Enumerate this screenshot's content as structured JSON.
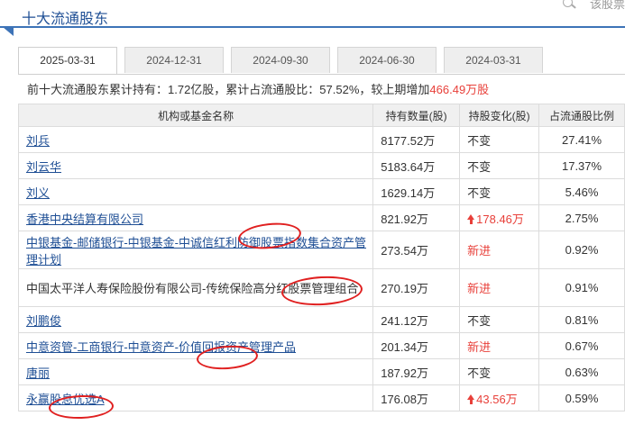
{
  "header": {
    "title": "十大流通股东",
    "search_text": "该股票"
  },
  "tabs": [
    {
      "label": "2025-03-31",
      "active": true
    },
    {
      "label": "2024-12-31",
      "active": false
    },
    {
      "label": "2024-09-30",
      "active": false
    },
    {
      "label": "2024-06-30",
      "active": false
    },
    {
      "label": "2024-03-31",
      "active": false
    }
  ],
  "summary": {
    "text_before": "前十大流通股东累计持有：1.72亿股，累计占流通股比：57.52%，较上期增加",
    "increase": "466.49万股"
  },
  "table": {
    "columns": [
      "机构或基金名称",
      "持有数量(股)",
      "持股变化(股)",
      "占流通股比例"
    ],
    "rows": [
      {
        "name": "刘兵",
        "link": true,
        "qty": "8177.52万",
        "change": "不变",
        "change_type": "same",
        "ratio": "27.41%"
      },
      {
        "name": "刘云华",
        "link": true,
        "qty": "5183.64万",
        "change": "不变",
        "change_type": "same",
        "ratio": "17.37%"
      },
      {
        "name": "刘义",
        "link": true,
        "qty": "1629.14万",
        "change": "不变",
        "change_type": "same",
        "ratio": "5.46%"
      },
      {
        "name": "香港中央结算有限公司",
        "link": true,
        "qty": "821.92万",
        "change": "178.46万",
        "change_type": "up",
        "ratio": "2.75%"
      },
      {
        "name": "中银基金-邮储银行-中银基金-中诚信红利防御股票指数集合资产管理计划",
        "link": true,
        "qty": "273.54万",
        "change": "新进",
        "change_type": "new",
        "ratio": "0.92%"
      },
      {
        "name": "中国太平洋人寿保险股份有限公司-传统保险高分红股票管理组合",
        "link": false,
        "qty": "270.19万",
        "change": "新进",
        "change_type": "new",
        "ratio": "0.91%"
      },
      {
        "name": "刘鹏俊",
        "link": true,
        "qty": "241.12万",
        "change": "不变",
        "change_type": "same",
        "ratio": "0.81%"
      },
      {
        "name": "中意资管-工商银行-中意资产-价值回报资产管理产品",
        "link": true,
        "qty": "201.34万",
        "change": "新进",
        "change_type": "new",
        "ratio": "0.67%"
      },
      {
        "name": "唐丽",
        "link": true,
        "qty": "187.92万",
        "change": "不变",
        "change_type": "same",
        "ratio": "0.63%"
      },
      {
        "name": "永赢股息优选A",
        "link": true,
        "qty": "176.08万",
        "change": "43.56万",
        "change_type": "up",
        "ratio": "0.59%"
      }
    ]
  },
  "colors": {
    "brand_blue": "#1f4f95",
    "accent_red": "#e8403a",
    "annotation_red": "#e02020"
  }
}
